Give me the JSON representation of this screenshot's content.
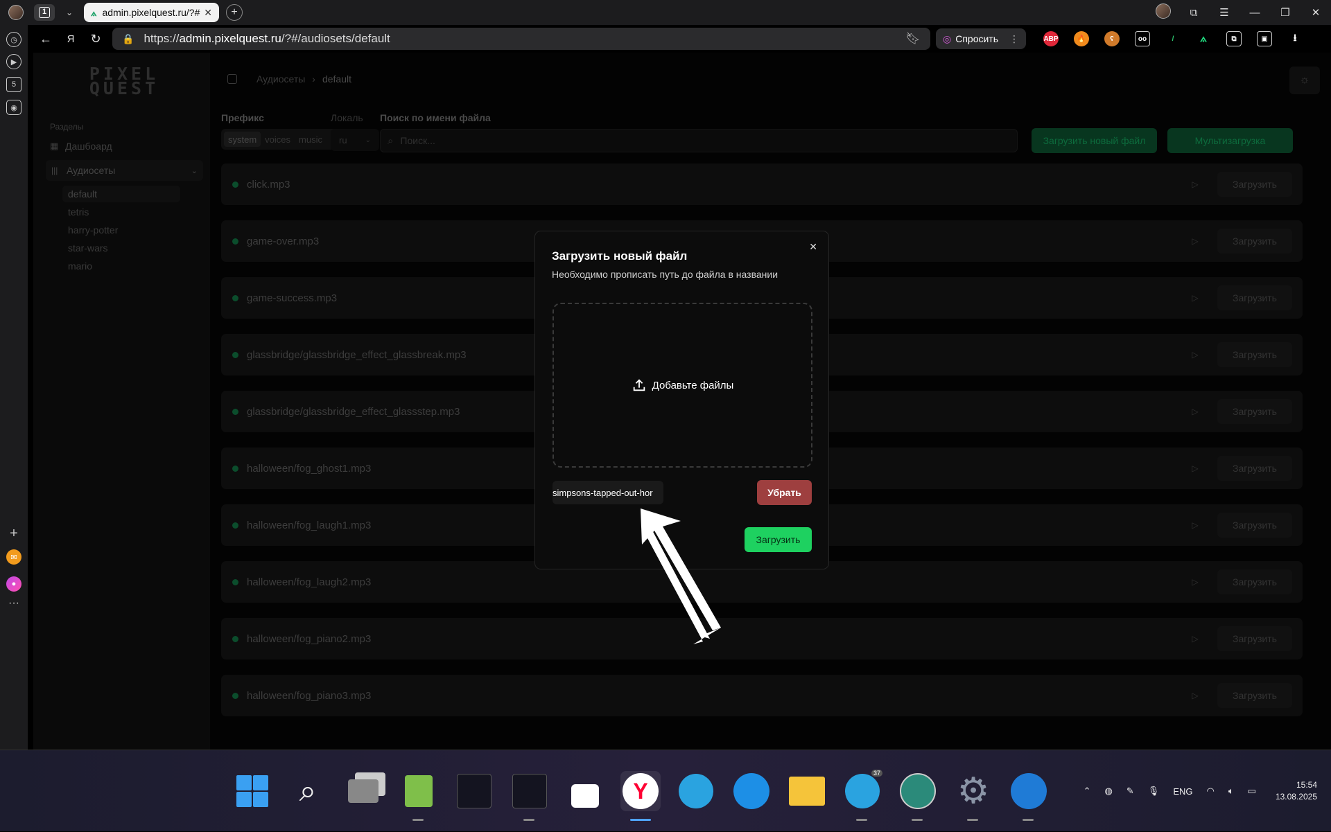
{
  "browser": {
    "tab_count": "1",
    "active_tab_title": "admin.pixelquest.ru/?#",
    "url_prefix": "https://",
    "url_host": "admin.pixelquest.ru",
    "url_path": "/?#/audiosets/default",
    "ask_button": "Спросить",
    "ext_abp": "ABP",
    "rail_badge": "5"
  },
  "sidebar": {
    "logo_line1": "PIXEL",
    "logo_line2": "QUEST",
    "section_label": "Разделы",
    "dashboard": "Дашбоард",
    "audiosets": "Аудиосеты",
    "sets": [
      "default",
      "tetris",
      "harry-potter",
      "star-wars",
      "mario"
    ]
  },
  "header": {
    "breadcrumb_root": "Аудиосеты",
    "breadcrumb_current": "default"
  },
  "filters": {
    "prefix_label": "Префикс",
    "prefix_options": [
      "system",
      "voices",
      "music"
    ],
    "locale_label": "Локаль",
    "locale_value": "ru",
    "search_label": "Поиск по имени файла",
    "search_placeholder": "Поиск...",
    "upload_new": "Загрузить новый файл",
    "multi_upload": "Мультизагрузка"
  },
  "files": [
    "click.mp3",
    "game-over.mp3",
    "game-success.mp3",
    "glassbridge/glassbridge_effect_glassbreak.mp3",
    "glassbridge/glassbridge_effect_glassstep.mp3",
    "halloween/fog_ghost1.mp3",
    "halloween/fog_laugh1.mp3",
    "halloween/fog_laugh2.mp3",
    "halloween/fog_piano2.mp3",
    "halloween/fog_piano3.mp3"
  ],
  "row_upload_label": "Загрузить",
  "modal": {
    "title": "Загрузить новый файл",
    "description": "Необходимо прописать путь до файла в названии",
    "dropzone": "Добавьте файлы",
    "file_name": "simpsons-tapped-out-hor",
    "remove": "Убрать",
    "upload": "Загрузить"
  },
  "taskbar": {
    "lang": "ENG",
    "time": "15:54",
    "date": "13.08.2025",
    "telegram_badge": "37"
  }
}
